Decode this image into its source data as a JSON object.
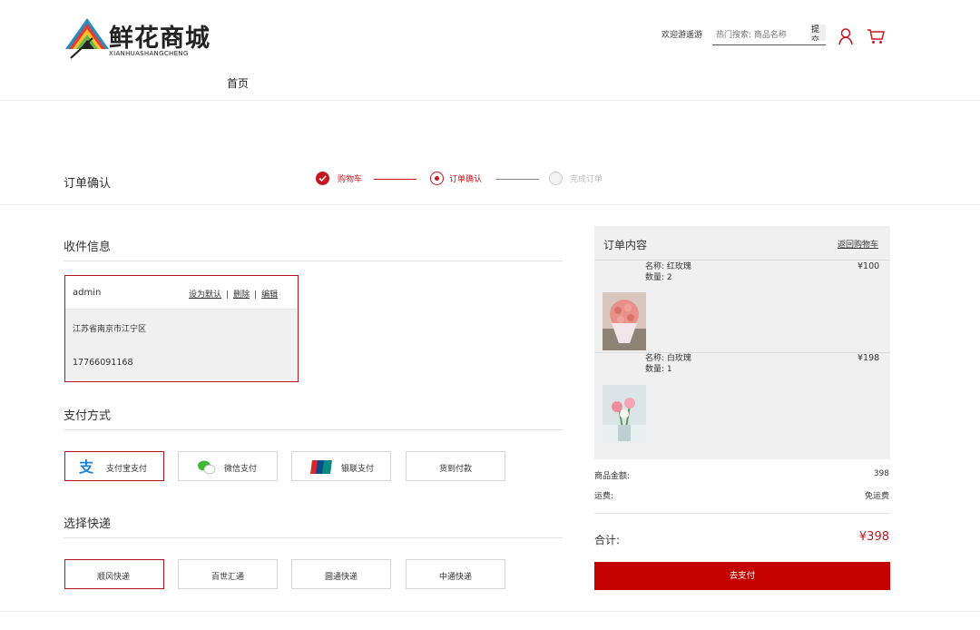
{
  "header": {
    "logo_title": "鲜花商城",
    "logo_subtitle": "XIANHUASHANGCHENG",
    "nav_home": "首页",
    "welcome": "欢迎游遥游",
    "search_placeholder": "热门搜索: 商品名称",
    "submit_label": "提交"
  },
  "page_title": "订单确认",
  "steps": [
    {
      "label": "购物车",
      "state": "done"
    },
    {
      "label": "订单确认",
      "state": "current"
    },
    {
      "label": "完成订单",
      "state": "pending"
    }
  ],
  "shipping_info": {
    "title": "收件信息",
    "name": "admin",
    "actions": [
      "设为默认",
      "删除",
      "编辑"
    ],
    "address": "江苏省南京市江宁区",
    "phone": "17766091168"
  },
  "payment": {
    "title": "支付方式",
    "options": [
      "支付宝支付",
      "微信支付",
      "银联支付",
      "货到付款"
    ],
    "selected": "支付宝支付"
  },
  "express": {
    "title": "选择快递",
    "options": [
      "顺风快递",
      "百世汇通",
      "圆通快递",
      "中通快递"
    ],
    "selected": "顺风快递"
  },
  "order": {
    "title": "订单内容",
    "back_to_cart": "返回购物车",
    "items": [
      {
        "name": "名称: 红玫瑰",
        "qty": "数量: 2",
        "price": "¥100"
      },
      {
        "name": "名称: 白玫瑰",
        "qty": "数量: 1",
        "price": "¥198"
      }
    ],
    "goods_amount_label": "商品金额:",
    "goods_amount": "398",
    "shipping_label": "运费:",
    "shipping_value": "免运费",
    "total_label": "合计:",
    "total_value": "¥398",
    "pay_button": "去支付"
  },
  "colors": {
    "accent": "#c8161d",
    "pay_button": "#c40000"
  }
}
